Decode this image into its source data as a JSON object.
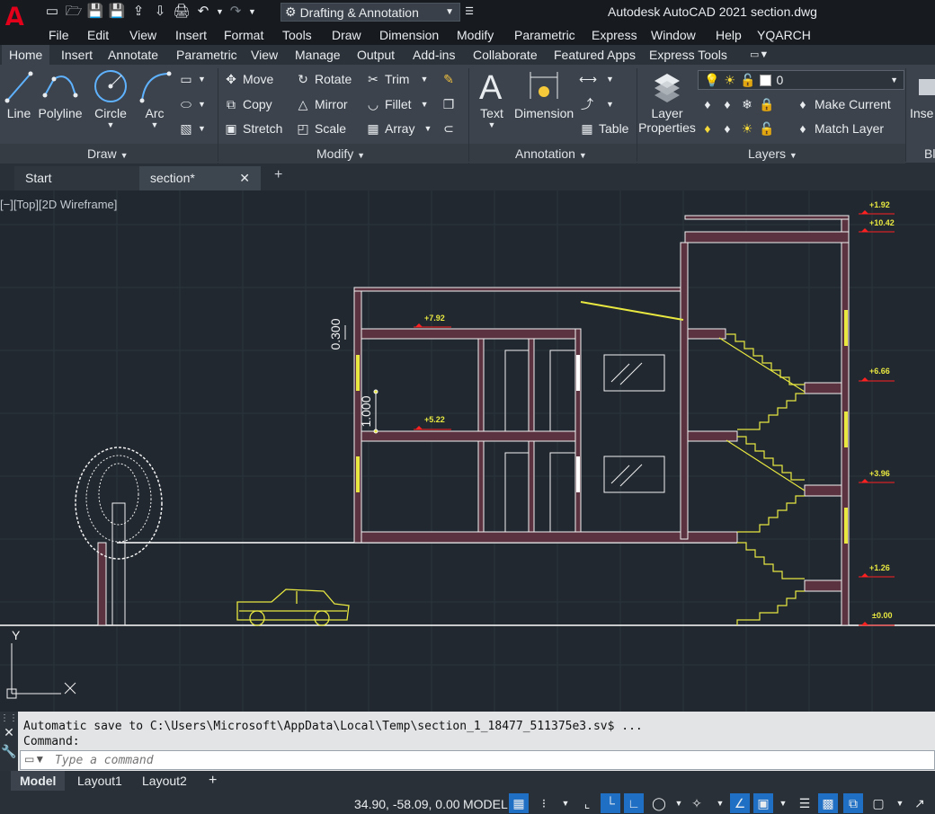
{
  "titlebar": {
    "workspace": "Drafting & Annotation",
    "app_title": "Autodesk AutoCAD 2021",
    "file_title": "section.dwg"
  },
  "menu": [
    "File",
    "Edit",
    "View",
    "Insert",
    "Format",
    "Tools",
    "Draw",
    "Dimension",
    "Modify",
    "Parametric",
    "Express",
    "Window",
    "Help",
    "YQARCH"
  ],
  "ribbon_tabs": [
    "Home",
    "Insert",
    "Annotate",
    "Parametric",
    "View",
    "Manage",
    "Output",
    "Add-ins",
    "Collaborate",
    "Featured Apps",
    "Express Tools"
  ],
  "ribbon": {
    "draw": {
      "title": "Draw",
      "line": "Line",
      "polyline": "Polyline",
      "circle": "Circle",
      "arc": "Arc"
    },
    "modify": {
      "title": "Modify",
      "move": "Move",
      "rotate": "Rotate",
      "trim": "Trim",
      "copy": "Copy",
      "mirror": "Mirror",
      "fillet": "Fillet",
      "stretch": "Stretch",
      "scale": "Scale",
      "array": "Array"
    },
    "annotation": {
      "title": "Annotation",
      "text": "Text",
      "dimension": "Dimension",
      "table": "Table"
    },
    "layers": {
      "title": "Layers",
      "properties_line1": "Layer",
      "properties_line2": "Properties",
      "current_layer": "0",
      "make_current": "Make Current",
      "match_layer": "Match Layer"
    },
    "insert": {
      "label": "Inse",
      "block_label": "Bl"
    }
  },
  "file_tabs": {
    "start": "Start",
    "active": "section*"
  },
  "viewport": {
    "label": "[−][Top][2D Wireframe]"
  },
  "drawing": {
    "dimension_top": "0.300",
    "dimension_side": "1.000",
    "levels_left": [
      "+7.92",
      "+5.22"
    ],
    "levels_right": [
      "+1.92",
      "+10.42",
      "+6.66",
      "+3.96",
      "+1.26",
      "±0.00"
    ],
    "ucs_y": "Y"
  },
  "command": {
    "history_1": "Automatic save to C:\\Users\\Microsoft\\AppData\\Local\\Temp\\section_1_18477_511375e3.sv$ ...",
    "history_2": "Command:",
    "placeholder": "Type a command"
  },
  "layout_tabs": [
    "Model",
    "Layout1",
    "Layout2"
  ],
  "status": {
    "coords": "34.90, -58.09, 0.00",
    "mode": "MODEL"
  },
  "colors": {
    "accent": "#1f6fc5",
    "logo": "#e2001a",
    "wall": "#5a3240",
    "yellow": "#e8e840",
    "marker": "#ff2020"
  }
}
